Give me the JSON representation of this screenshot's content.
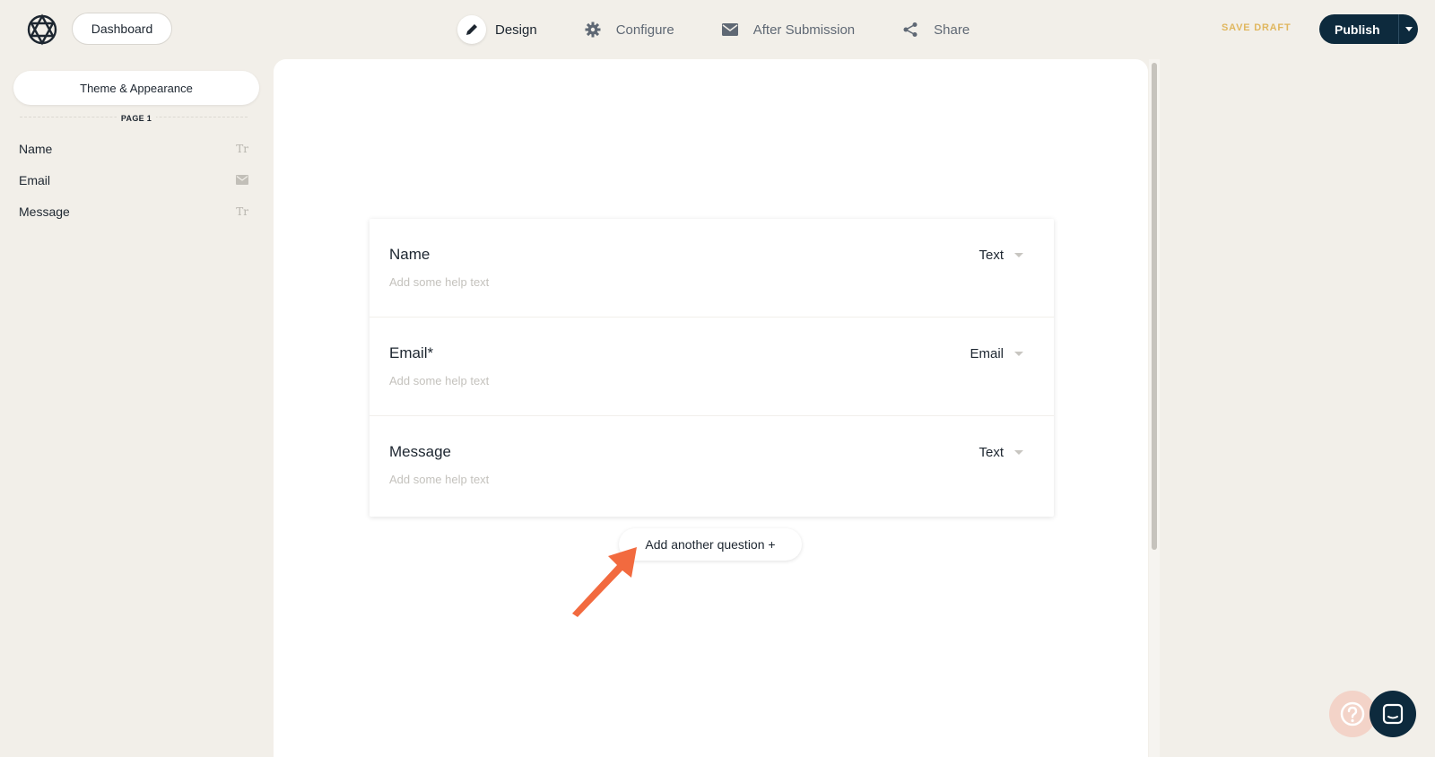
{
  "header": {
    "dashboard_label": "Dashboard",
    "nav": [
      {
        "label": "Design",
        "icon": "pencil-icon",
        "active": true
      },
      {
        "label": "Configure",
        "icon": "gear-icon",
        "active": false
      },
      {
        "label": "After Submission",
        "icon": "envelope-icon",
        "active": false
      },
      {
        "label": "Share",
        "icon": "share-icon",
        "active": false
      }
    ],
    "save_draft_label": "SAVE DRAFT",
    "publish_label": "Publish"
  },
  "sidebar": {
    "theme_label": "Theme & Appearance",
    "page_label": "PAGE 1",
    "items": [
      {
        "label": "Name",
        "icon": "text-type-icon",
        "glyph": "Tr"
      },
      {
        "label": "Email",
        "icon": "envelope-icon"
      },
      {
        "label": "Message",
        "icon": "text-type-icon",
        "glyph": "Tr"
      }
    ]
  },
  "form": {
    "questions": [
      {
        "title": "Name",
        "help_placeholder": "Add some help text",
        "type": "Text"
      },
      {
        "title": "Email*",
        "help_placeholder": "Add some help text",
        "type": "Email"
      },
      {
        "title": "Message",
        "help_placeholder": "Add some help text",
        "type": "Text"
      }
    ],
    "add_question_label": "Add another question +"
  },
  "colors": {
    "background": "#f2efe9",
    "primary_dark": "#0d2a3d",
    "save_draft": "#e0b75f",
    "annotation_arrow": "#f26a3f",
    "help_button": "#f3d3c8"
  }
}
